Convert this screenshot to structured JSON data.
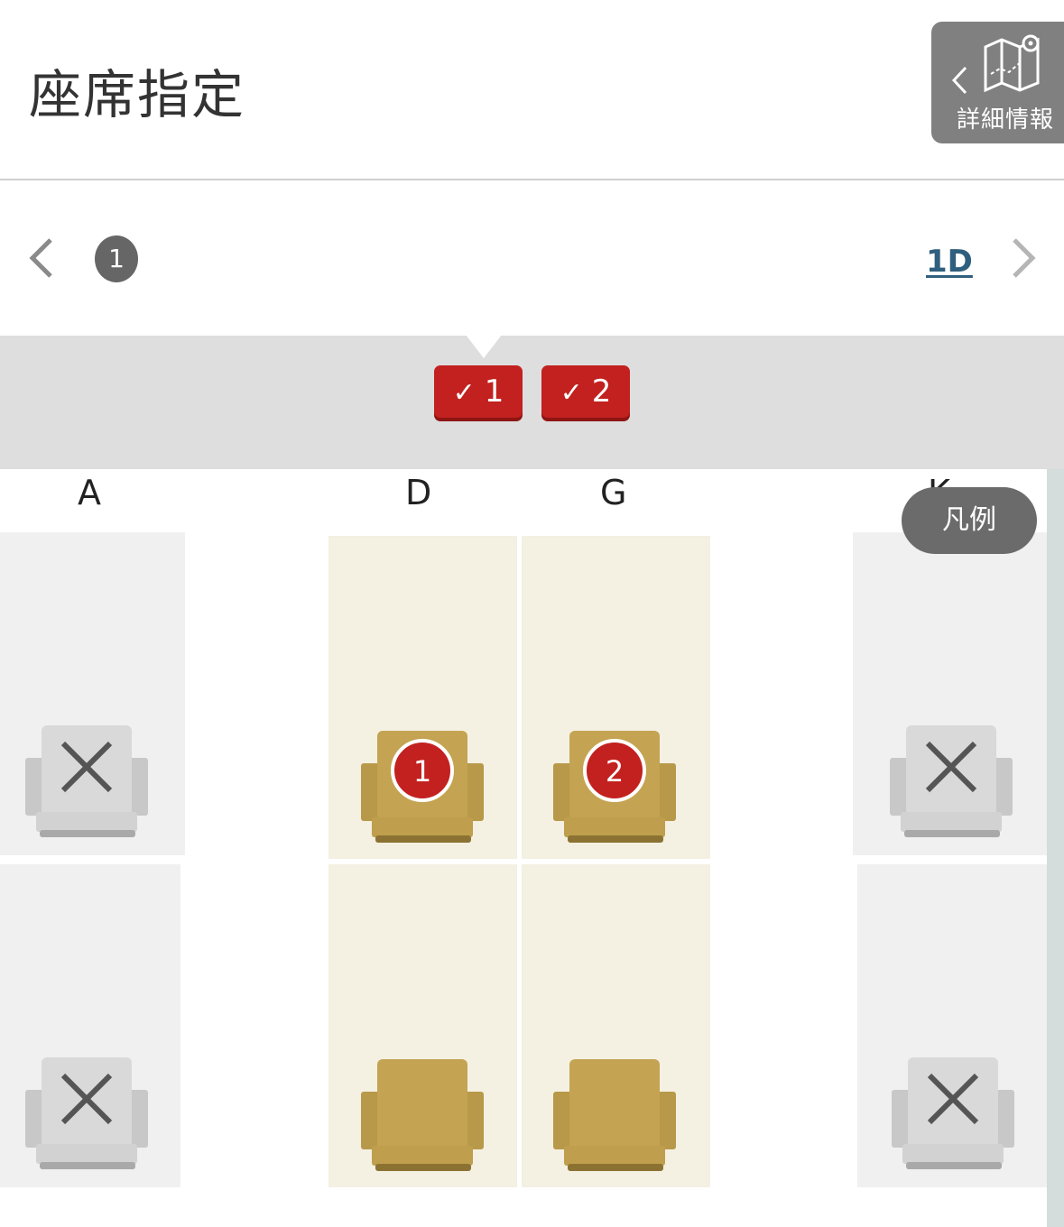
{
  "header": {
    "title": "座席指定",
    "detail_button_label": "詳細情報"
  },
  "pager": {
    "passenger_number": "1",
    "current_seat": "1D"
  },
  "selected_passengers": [
    {
      "check": "✓",
      "number": "1"
    },
    {
      "check": "✓",
      "number": "2"
    }
  ],
  "columns": [
    "A",
    "D",
    "G",
    "K"
  ],
  "legend_label": "凡例",
  "seat_map": {
    "rows": [
      {
        "A": "unavailable",
        "D": "selected-1",
        "G": "selected-2",
        "K": "unavailable"
      },
      {
        "A": "unavailable",
        "D": "available",
        "G": "available",
        "K": "unavailable"
      }
    ],
    "assigned": {
      "D1": "1",
      "G1": "2"
    }
  },
  "colors": {
    "selected_badge": "#c2211f",
    "available_seat": "#b8994a",
    "unavailable_seat": "#c8c8c8",
    "cream_zone": "#f4f0e2",
    "grey_zone": "#f0f0f0",
    "link": "#2f5f7e"
  }
}
